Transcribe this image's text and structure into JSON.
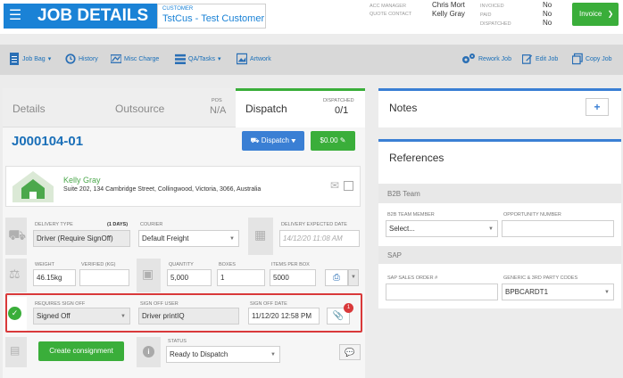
{
  "header": {
    "title": "JOB DETAILS",
    "customer_label": "CUSTOMER",
    "customer_name": "TstCus - Test Customer",
    "acc_manager_label": "ACC MANAGER",
    "acc_manager": "Chris Mort",
    "quote_contact_label": "QUOTE CONTACT",
    "quote_contact": "Kelly Gray",
    "invoiced_label": "INVOICED",
    "invoiced": "No",
    "paid_label": "PAID",
    "paid": "No",
    "dispatched_label": "DISPATCHED",
    "dispatched": "No",
    "invoice_button": "Invoice"
  },
  "toolbar": {
    "job_bag": "Job Bag",
    "history": "History",
    "misc_charge": "Misc Charge",
    "qa_tasks": "QA/Tasks",
    "artwork": "Artwork",
    "rework_job": "Rework Job",
    "edit_job": "Edit Job",
    "copy_job": "Copy Job"
  },
  "tabs": {
    "details": "Details",
    "outsource": "Outsource",
    "pos_label": "POS",
    "pos_value": "N/A",
    "dispatch": "Dispatch",
    "dispatched_label": "DISPATCHED",
    "dispatched_value": "0/1"
  },
  "job": {
    "id": "J000104-01",
    "dispatch_button": "Dispatch",
    "amount_button": "$0.00"
  },
  "contact": {
    "name": "Kelly Gray",
    "address": "Suite 202, 134 Cambridge Street, Collingwood, Victoria, 3066, Australia"
  },
  "delivery": {
    "type_label": "DELIVERY TYPE",
    "type_days": "(1 DAYS)",
    "type_value": "Driver (Require SignOff)",
    "courier_label": "COURIER",
    "courier_value": "Default Freight",
    "expected_label": "DELIVERY EXPECTED DATE",
    "expected_value": "14/12/20 11:08 AM"
  },
  "package": {
    "weight_label": "WEIGHT",
    "weight_value": "46.15kg",
    "verified_label": "VERIFIED (KG)",
    "verified_value": "",
    "quantity_label": "QUANTITY",
    "quantity_value": "5,000",
    "boxes_label": "BOXES",
    "boxes_value": "1",
    "items_label": "ITEMS PER BOX",
    "items_value": "5000"
  },
  "signoff": {
    "requires_label": "REQUIRES SIGN OFF",
    "requires_value": "Signed Off",
    "user_label": "SIGN OFF USER",
    "user_value": "Driver printIQ",
    "date_label": "SIGN OFF DATE",
    "date_value": "11/12/20 12:58 PM",
    "attachment_count": "1"
  },
  "footer": {
    "create_button": "Create consignment",
    "status_label": "STATUS",
    "status_value": "Ready to Dispatch"
  },
  "right": {
    "notes_title": "Notes",
    "references_title": "References",
    "b2b_section": "B2B Team",
    "b2b_member_label": "B2B TEAM MEMBER",
    "b2b_member_value": "Select...",
    "opportunity_label": "OPPORTUNITY NUMBER",
    "opportunity_value": "",
    "sap_section": "SAP",
    "sap_order_label": "SAP SALES ORDER #",
    "sap_order_value": "",
    "generic_codes_label": "GENERIC & 3RD PARTY CODES",
    "generic_codes_value": "BPBCARDT1"
  },
  "colors": {
    "brand_blue": "#1a82d6",
    "success_green": "#3aae3a",
    "highlight_red": "#d9393a"
  }
}
